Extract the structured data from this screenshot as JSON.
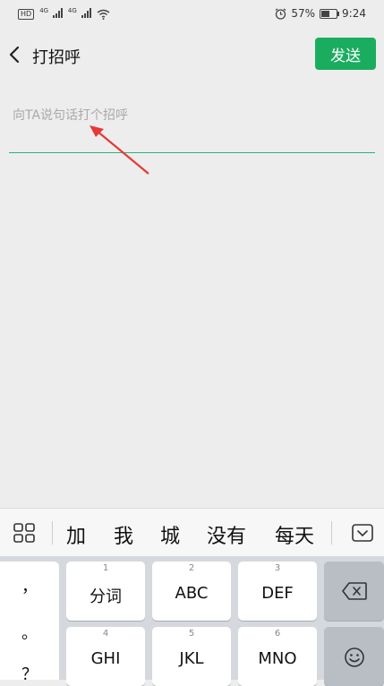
{
  "status_bar": {
    "hd": "HD",
    "signal_1_label": "4G",
    "signal_2_label": "4G",
    "battery_percent": "57%",
    "battery_level": 0.57,
    "time": "9:24",
    "icons": [
      "hd-icon",
      "signal-icon",
      "signal-icon",
      "wifi-icon",
      "alarm-icon",
      "battery-icon"
    ]
  },
  "header": {
    "back_icon": "chevron-left-icon",
    "title": "打招呼",
    "send_label": "发送",
    "send_color": "#1aad5f"
  },
  "input": {
    "placeholder": "向TA说句话打个招呼",
    "underline_color": "#23b57a"
  },
  "annotation": {
    "arrow_color": "#e53935"
  },
  "candidate_bar": {
    "menu_icon": "grid-icon",
    "candidates": [
      "加",
      "我",
      "城",
      "没有",
      "每天"
    ],
    "collapse_icon": "keyboard-collapse-icon"
  },
  "keyboard": {
    "punctuation": [
      "，",
      "。",
      "？"
    ],
    "row1": [
      {
        "num": "1",
        "label": "分词"
      },
      {
        "num": "2",
        "label": "ABC"
      },
      {
        "num": "3",
        "label": "DEF"
      }
    ],
    "row2": [
      {
        "num": "4",
        "label": "GHI"
      },
      {
        "num": "5",
        "label": "JKL"
      },
      {
        "num": "6",
        "label": "MNO"
      }
    ],
    "delete_icon": "backspace-icon",
    "emoji_icon": "emoji-icon"
  }
}
